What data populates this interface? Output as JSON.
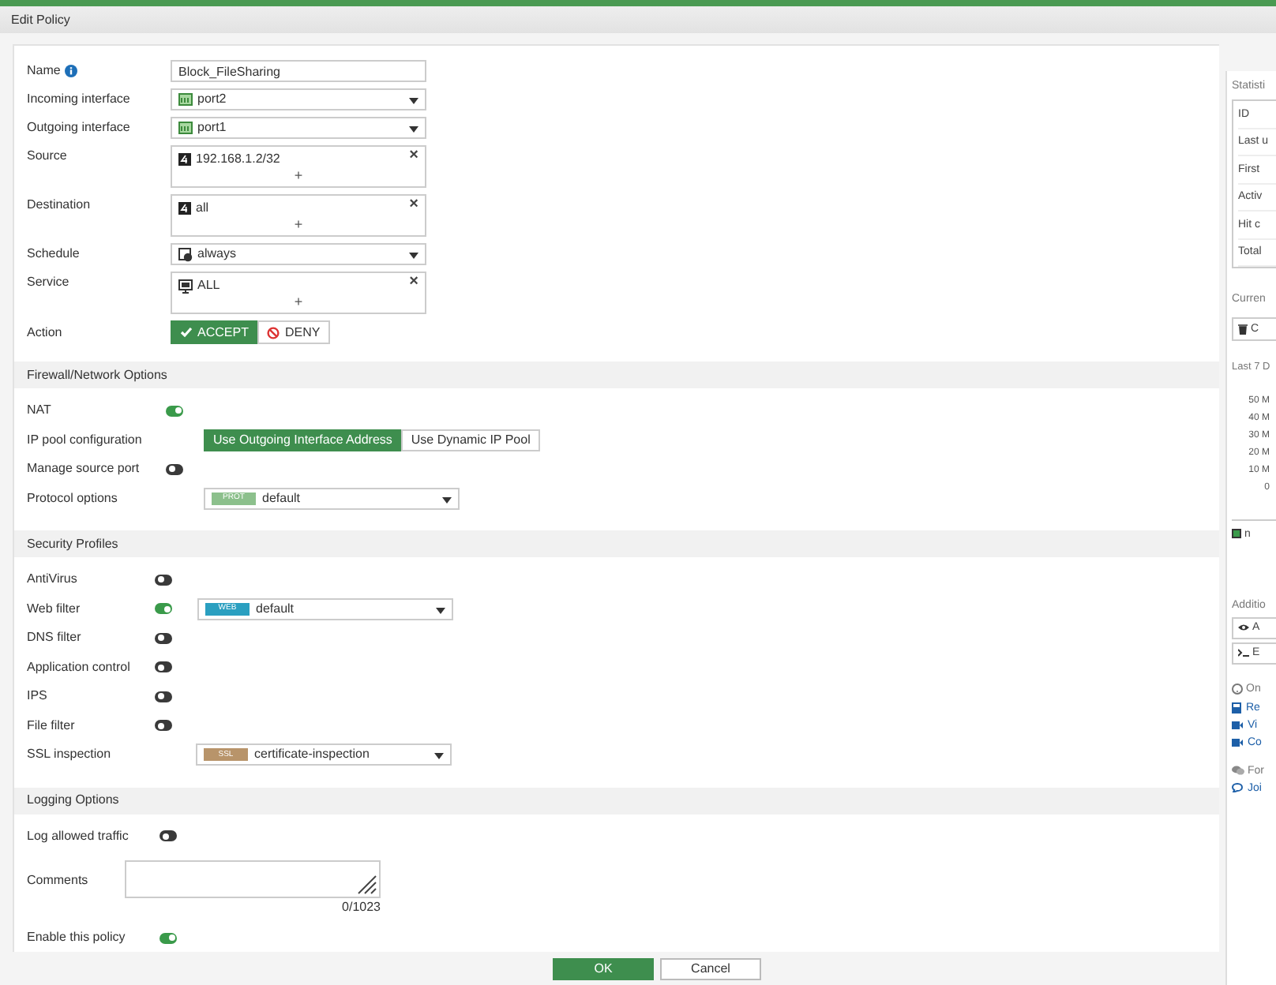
{
  "window": {
    "title": "Edit Policy"
  },
  "fields": [
    {
      "kind": "text",
      "label": "Name",
      "info": true,
      "value": "Block_FileSharing"
    },
    {
      "kind": "select",
      "label": "Incoming interface",
      "value": "port2"
    },
    {
      "kind": "select",
      "label": "Outgoing interface",
      "value": "port1"
    },
    {
      "kind": "multi",
      "label": "Source",
      "value": "192.168.1.2/32",
      "remove": "×",
      "add": "+"
    },
    {
      "kind": "multi",
      "label": "Destination",
      "value": "all",
      "remove": "×",
      "add": "+"
    },
    {
      "kind": "select",
      "label": "Schedule",
      "value": "always"
    },
    {
      "kind": "multi",
      "label": "Service",
      "value": "ALL",
      "remove": "×",
      "add": "+"
    },
    {
      "kind": "action",
      "label": "Action",
      "options": [
        {
          "label": "ACCEPT",
          "selected": true
        },
        {
          "label": "DENY",
          "selected": false
        }
      ]
    }
  ],
  "sections": [
    {
      "title": "Firewall/Network Options",
      "rows": [
        {
          "kind": "toggle",
          "label": "NAT",
          "on": true
        },
        {
          "kind": "segmented",
          "label": "IP pool configuration",
          "options": [
            {
              "label": "Use Outgoing Interface Address",
              "selected": true
            },
            {
              "label": "Use Dynamic IP Pool",
              "selected": false
            }
          ]
        },
        {
          "kind": "toggle",
          "label": "Manage source port",
          "on": false
        },
        {
          "kind": "profile",
          "label": "Protocol options",
          "tag": "PROT",
          "color": "#8cc08c",
          "value": "default"
        }
      ]
    },
    {
      "title": "Security Profiles",
      "rows": [
        {
          "kind": "toggle",
          "label": "AntiVirus",
          "on": false
        },
        {
          "kind": "toggle",
          "label": "Web filter",
          "on": true,
          "tag": "WEB",
          "color": "#2a9fc0",
          "value": "default"
        },
        {
          "kind": "toggle",
          "label": "DNS filter",
          "on": false
        },
        {
          "kind": "toggle",
          "label": "Application control",
          "on": false
        },
        {
          "kind": "toggle",
          "label": "IPS",
          "on": false
        },
        {
          "kind": "toggle",
          "label": "File filter",
          "on": false
        },
        {
          "kind": "profile",
          "label": "SSL inspection",
          "tag": "SSL",
          "color": "#b8946a",
          "value": "certificate-inspection"
        }
      ]
    },
    {
      "title": "Logging Options",
      "rows": [
        {
          "kind": "toggle",
          "label": "Log allowed traffic",
          "on": false
        },
        {
          "kind": "textarea",
          "label": "Comments",
          "counter": "0/1023"
        },
        {
          "kind": "toggle",
          "label": "Enable this policy",
          "on": true
        }
      ]
    }
  ],
  "buttons": [
    {
      "label": "OK",
      "primary": true
    },
    {
      "label": "Cancel",
      "primary": false
    }
  ],
  "sidebar": {
    "statistics_title": "Statisti",
    "statistics_rows": [
      "ID",
      "Last u",
      "First",
      "Activ",
      "Hit c",
      "Total"
    ],
    "current_title": "Curren",
    "clear_button": "C",
    "last7_title": "Last 7 D",
    "chart_ticks": [
      "50 M",
      "40 M",
      "30 M",
      "20 M",
      "10 M",
      "0"
    ],
    "legend": "n",
    "additional_title": "Additio",
    "additional_buttons": [
      "A",
      "E"
    ],
    "help_title": "On",
    "help_links": [
      "Re",
      "Vi",
      "Co"
    ],
    "forum_title": "For",
    "forum_link": "Joi"
  }
}
